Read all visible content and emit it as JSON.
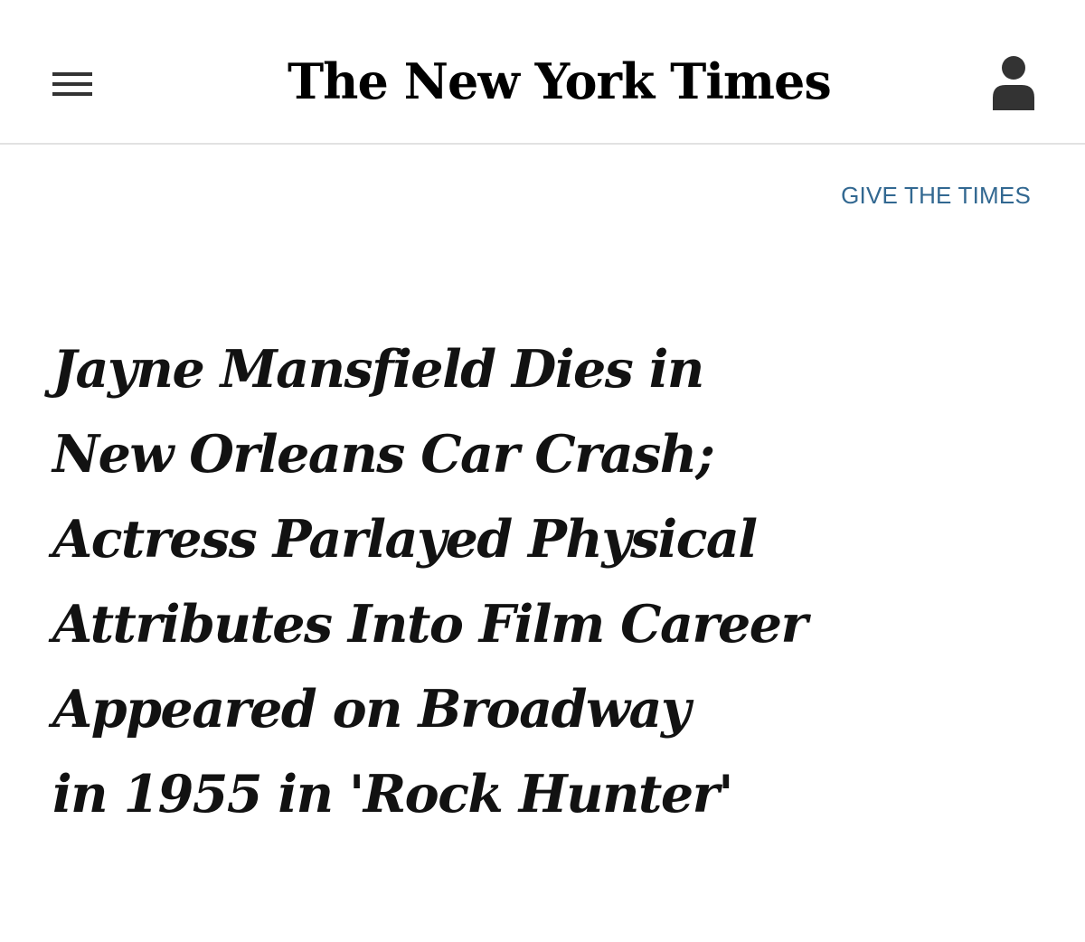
{
  "header": {
    "logo_text": "The New York Times",
    "menu_icon": "hamburger-menu-icon",
    "account_icon": "user-icon"
  },
  "promo": {
    "give_label": "GIVE THE TIMES"
  },
  "article": {
    "headline_lines": [
      "Jayne Mansfield Dies in",
      "New Orleans Car Crash;",
      "Actress Parlayed Physical",
      "Attributes Into Film Career",
      "Appeared on Broadway",
      "in 1955 in 'Rock Hunter'"
    ]
  },
  "colors": {
    "link": "#326891",
    "text": "#121212",
    "divider": "#e2e2e2"
  }
}
